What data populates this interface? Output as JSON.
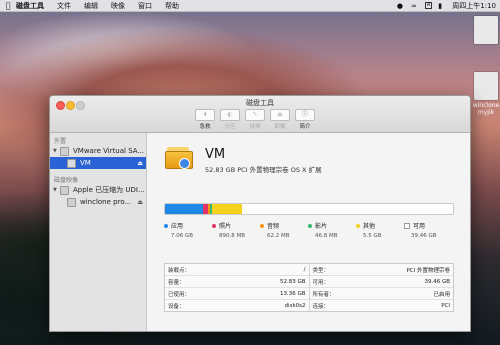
{
  "menubar": {
    "app_name": "磁盘工具",
    "items": [
      "文件",
      "编辑",
      "映像",
      "窗口",
      "帮助"
    ],
    "input_label": "A",
    "clock": "周四上午1:10"
  },
  "desktop": {
    "files": [
      "",
      "winclone myjik"
    ]
  },
  "window": {
    "title": "磁盘工具",
    "toolbar": [
      {
        "label": "急救",
        "enabled": true
      },
      {
        "label": "分区",
        "enabled": false
      },
      {
        "label": "抹掉",
        "enabled": false
      },
      {
        "label": "卸载",
        "enabled": false
      },
      {
        "label": "简介",
        "enabled": true
      }
    ]
  },
  "sidebar": {
    "section_external": "外置",
    "external_disk": "VMware Virtual SA...",
    "external_volume": "VM",
    "section_images": "磁盘映像",
    "image_disk": "Apple 已压缩为 UDI...",
    "image_volume": "winclone pro..."
  },
  "volume": {
    "name": "VM",
    "description": "52.83 GB PCI 外置物理宗卷 OS X 扩展"
  },
  "usage": {
    "total_gb": 52.83,
    "legend": [
      {
        "label": "应用",
        "size": "7.06 GB",
        "value_gb": 7.06,
        "color": "#1e88e5"
      },
      {
        "label": "照片",
        "size": "890.8 MB",
        "value_gb": 0.89,
        "color": "#e53264"
      },
      {
        "label": "音频",
        "size": "62.2 MB",
        "value_gb": 0.06,
        "color": "#f39a12"
      },
      {
        "label": "影片",
        "size": "46.8 MB",
        "value_gb": 0.05,
        "color": "#34b96f"
      },
      {
        "label": "其他",
        "size": "5.5 GB",
        "value_gb": 5.5,
        "color": "#f6d21c"
      },
      {
        "label": "可用",
        "size": "39.46 GB",
        "value_gb": 39.46,
        "color": "#ffffff"
      }
    ]
  },
  "info": {
    "left": [
      {
        "key": "装载点：",
        "value": "/"
      },
      {
        "key": "容量：",
        "value": "52.83 GB"
      },
      {
        "key": "已使用：",
        "value": "13.36 GB"
      },
      {
        "key": "设备：",
        "value": "disk0s2"
      }
    ],
    "right": [
      {
        "key": "类型：",
        "value": "PCI 外置物理宗卷"
      },
      {
        "key": "可用：",
        "value": "39.46 GB"
      },
      {
        "key": "所有者：",
        "value": "已启用"
      },
      {
        "key": "连接：",
        "value": "PCI"
      }
    ]
  }
}
